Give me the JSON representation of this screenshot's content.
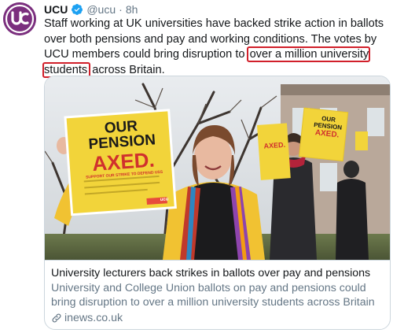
{
  "tweet": {
    "author_name": "UCU",
    "handle": "@ucu",
    "separator": "·",
    "time": "8h",
    "text_before": "Staff working at UK universities have backed strike action in ballots over both pensions and pay and working conditions. The votes by UCU members could bring disruption to ",
    "text_highlight": "over a million university students",
    "text_after": " across Britain.",
    "avatar_logo_text": "UCU",
    "highlight_color": "#d11f2a",
    "brand_color": "#7b2f7e",
    "verified_color": "#1da1f2"
  },
  "card": {
    "title": "University lecturers back strikes in ballots over pay and pensions",
    "description": "University and College Union ballots on pay and pensions could bring disruption to over a million university students across Britain",
    "domain": "inews.co.uk",
    "image": {
      "placard_main_line1": "OUR",
      "placard_main_line2": "PENSION",
      "placard_main_line3": "AXED.",
      "placard_main_small": "SUPPORT OUR STRIKE TO DEFEND USS",
      "placard_logo": "ucu",
      "placard_small_left": "AXED.",
      "placard_right_line1": "OUR",
      "placard_right_line2": "PENSION",
      "placard_right_line3": "AXED."
    }
  }
}
